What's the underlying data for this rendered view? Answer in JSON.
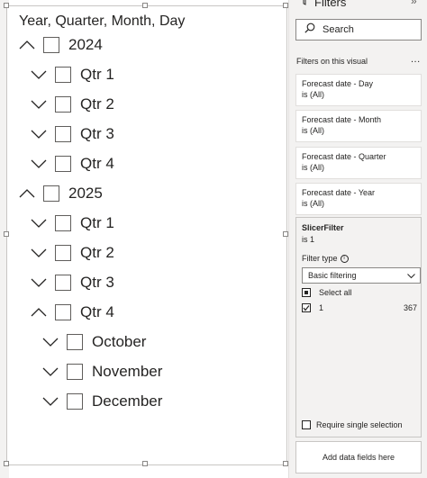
{
  "slicer": {
    "title": "Year, Quarter, Month, Day",
    "rows": [
      {
        "label": "2024",
        "expanded": true,
        "level": 0
      },
      {
        "label": "Qtr 1",
        "expanded": false,
        "level": 1
      },
      {
        "label": "Qtr 2",
        "expanded": false,
        "level": 1
      },
      {
        "label": "Qtr 3",
        "expanded": false,
        "level": 1
      },
      {
        "label": "Qtr 4",
        "expanded": false,
        "level": 1
      },
      {
        "label": "2025",
        "expanded": true,
        "level": 0
      },
      {
        "label": "Qtr 1",
        "expanded": false,
        "level": 1
      },
      {
        "label": "Qtr 2",
        "expanded": false,
        "level": 1
      },
      {
        "label": "Qtr 3",
        "expanded": false,
        "level": 1
      },
      {
        "label": "Qtr 4",
        "expanded": true,
        "level": 1
      },
      {
        "label": "October",
        "expanded": false,
        "level": 2
      },
      {
        "label": "November",
        "expanded": false,
        "level": 2
      },
      {
        "label": "December",
        "expanded": false,
        "level": 2
      }
    ]
  },
  "filters_pane": {
    "title": "Filters",
    "collapse_glyph": "»",
    "search_placeholder": "Search",
    "section_label": "Filters on this visual",
    "more_glyph": "...",
    "cards": [
      {
        "title": "Forecast date - Day",
        "value": "is (All)"
      },
      {
        "title": "Forecast date - Month",
        "value": "is (All)"
      },
      {
        "title": "Forecast date - Quarter",
        "value": "is (All)"
      },
      {
        "title": "Forecast date - Year",
        "value": "is (All)"
      }
    ],
    "slicer_filter": {
      "title": "SlicerFilter",
      "value": "is 1",
      "filter_type_label": "Filter type",
      "info_glyph": "i",
      "filter_type_value": "Basic filtering",
      "select_all_label": "Select all",
      "options": [
        {
          "label": "1",
          "count": "367"
        }
      ],
      "require_single_label": "Require single selection"
    },
    "add_fields_label": "Add data fields here"
  }
}
